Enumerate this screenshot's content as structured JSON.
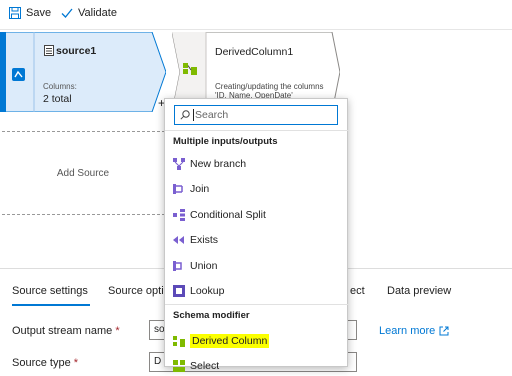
{
  "toolbar": {
    "save_label": "Save",
    "validate_label": "Validate"
  },
  "source_node": {
    "title": "source1",
    "columns_label": "Columns:",
    "columns_value": "2 total"
  },
  "derived_node": {
    "title": "DerivedColumn1",
    "description_line1": "Creating/updating the columns",
    "description_line2": "'ID, Name, OpenDate'"
  },
  "add_source_label": "Add Source",
  "add_button": "+",
  "panel": {
    "tabs": [
      "Source settings",
      "Source opti",
      "ect",
      "Data preview"
    ],
    "output_stream_label": "Output stream name",
    "output_stream_value": "so",
    "source_type_label": "Source type",
    "source_type_value": "D",
    "required_mark": "*",
    "learn_more": "Learn more"
  },
  "menu": {
    "search_placeholder": "Search",
    "section1": "Multiple inputs/outputs",
    "items1": [
      {
        "label": "New branch",
        "icon": "new-branch-icon"
      },
      {
        "label": "Join",
        "icon": "join-icon"
      },
      {
        "label": "Conditional Split",
        "icon": "conditional-split-icon"
      },
      {
        "label": "Exists",
        "icon": "exists-icon"
      },
      {
        "label": "Union",
        "icon": "union-icon"
      },
      {
        "label": "Lookup",
        "icon": "lookup-icon"
      }
    ],
    "section2": "Schema modifier",
    "items2": [
      {
        "label": "Derived Column",
        "icon": "derived-column-icon",
        "highlighted": true
      },
      {
        "label": "Select",
        "icon": "select-icon"
      }
    ]
  },
  "colors": {
    "accent": "#0078d4",
    "node_selected": "#dcebfa",
    "highlight": "#fbff00",
    "icon_purple": "#7a5fd0"
  }
}
